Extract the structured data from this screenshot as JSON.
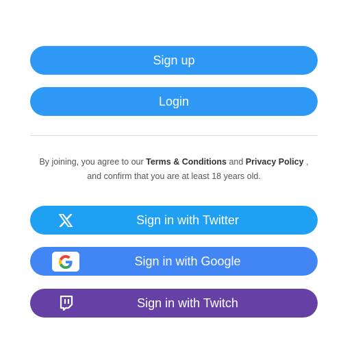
{
  "auth": {
    "signup_label": "Sign up",
    "login_label": "Login"
  },
  "terms": {
    "prefix": "By joining, you agree to our",
    "terms_link": "Terms & Conditions",
    "and": "and",
    "privacy_link": "Privacy Policy",
    "suffix": ",",
    "line2": "and confirm that you are at least 18 years old."
  },
  "social": {
    "twitter_label": "Sign in with Twitter",
    "google_label": "Sign in with Google",
    "twitch_label": "Sign in with Twitch"
  },
  "icons": {
    "twitter": "x-logo-icon",
    "google": "google-logo-icon",
    "twitch": "twitch-logo-icon"
  },
  "colors": {
    "primary": "#2d99f4",
    "twitter": "#1fa0f2",
    "google": "#4285f4",
    "twitch": "#6641a5"
  }
}
